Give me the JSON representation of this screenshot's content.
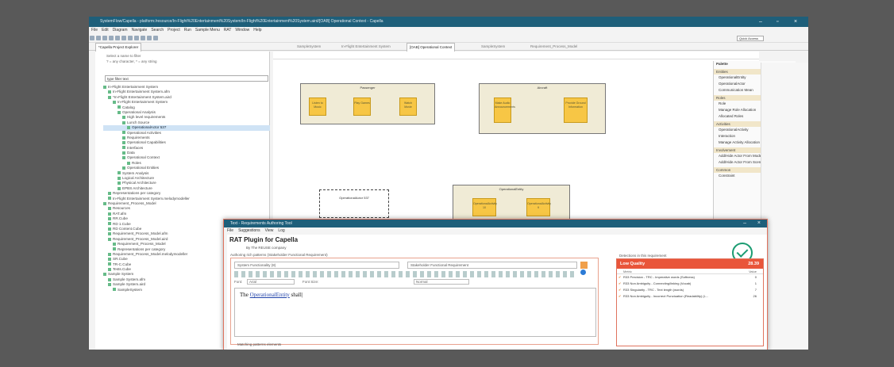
{
  "window": {
    "title": "SystemFlow/Capella - platform:/resource/In-Flight%20Entertainment%20System/In-Flight%20Entertainment%20System.aird/[OAB] Operational Context - Capella"
  },
  "menu": [
    "File",
    "Edit",
    "Diagram",
    "Navigate",
    "Search",
    "Project",
    "Run",
    "Sample Menu",
    "RAT",
    "Window",
    "Help"
  ],
  "quick_access": "Quick Access",
  "tabs": {
    "explorer": "*Capella Project Explorer",
    "editors": [
      "SampleSystem",
      "In-Flight Entertainment System",
      "[OAB] Operational Context",
      "SampleSystem",
      "Requirement_Process_Model"
    ]
  },
  "explorer": {
    "hint1": "Select a name to filter",
    "hint2": "? = any character, * = any string",
    "filter": "type filter text",
    "tree": [
      "In-Flight Entertainment System",
      "In-Flight Entertainment System.afm",
      "*In-Flight Entertainment System.aird",
      "In-Flight Entertainment System",
      "Catalog",
      "Operational Analysis",
      "High level requirements",
      "Lunch Source",
      "OperationalActor 537",
      "Operational Activities",
      "Requirements",
      "Operational Capabilities",
      "Interfaces",
      "Data",
      "Operational Context",
      "Roles",
      "Operational Entities",
      "System Analysis",
      "Logical Architecture",
      "Physical Architecture",
      "EPBS Architecture",
      "Representations per category",
      "In-Flight Entertainment System.melodymodeller",
      "Requirement_Process_Model",
      "Resources",
      "RAT.afm",
      "RR.Cube",
      "RD 1.Cube",
      "RD Content.Cube",
      "Requirement_Process_Model.afm",
      "Requirement_Process_Model.aird",
      "Requirement_Process_Model",
      "Representations per category",
      "Requirement_Process_Model.melodymodeller",
      "SR.Cube",
      "TR-C.Cube",
      "Tests.Cube",
      "Sample System",
      "Sample System.afm",
      "Sample System.aird",
      "SampleSystem"
    ]
  },
  "diagram": {
    "boxes": [
      {
        "label": "Passenger",
        "acts": [
          "Listen to Music",
          "Play Games",
          "Watch Movie"
        ]
      },
      {
        "label": "Aircraft",
        "acts": [
          "Make Audio Announcements",
          "Provide Ground Information"
        ]
      },
      {
        "label": "OperationalActor 537",
        "acts": []
      },
      {
        "label": "OperationalEntity",
        "acts": [
          "OperationalActivity 10",
          "OperationalActivity 9"
        ]
      }
    ]
  },
  "palette": {
    "title": "Palette",
    "sections": [
      {
        "name": "Entities",
        "items": [
          "OperationalEntity",
          "OperationalActor",
          "Communication Mean"
        ]
      },
      {
        "name": "Roles",
        "items": [
          "Role",
          "Manage Role Allocation",
          "Allocated Roles"
        ]
      },
      {
        "name": "Activities",
        "items": [
          "OperationalActivity",
          "Interaction",
          "Manage Activity Allocation"
        ]
      },
      {
        "name": "Involvement",
        "items": [
          "Add/Hide Actor From Mode / State",
          "Add/Hide Actor From Scenario"
        ]
      },
      {
        "name": "Common",
        "items": [
          "Constraint"
        ]
      }
    ]
  },
  "dialog": {
    "title": "Text - Requirements Authoring Tool",
    "menu": [
      "File",
      "Suggestions",
      "View",
      "Log"
    ],
    "plugin_title": "RAT Plugin for Capella",
    "by": "By The REUSE company",
    "authoring_label": "Authoring rich patterns (Stakeholder Functional Requirement)",
    "scope_select": "System Functionality (8)",
    "pattern_select": "Stakeholder Functional Requirement",
    "font_label": "Font:",
    "font_value": "Arial",
    "font_size_label": "Font Size:",
    "style_value": "Normal",
    "requirement_prefix": "The",
    "requirement_entity": "OperationalEntity",
    "requirement_suffix": "shall",
    "matching_label": "Matching patterns elements",
    "detections_label": "Detections in this requirement",
    "quality": {
      "label": "Low Quality",
      "score": "28.39",
      "col_metric": "Metric",
      "col_value": "Value",
      "rows": [
        {
          "metric": "R33 Precision - TRC - Imperative words (Softness)",
          "value": "0"
        },
        {
          "metric": "R33 Non Ambiguity - Connecting/linking (Vocab)",
          "value": "1"
        },
        {
          "metric": "R33 Singularity - TRC - Text length (words)",
          "value": "7"
        },
        {
          "metric": "R33 Non Ambiguity - Incorrect Punctuation (Readability) (L...",
          "value": "26"
        }
      ]
    }
  }
}
